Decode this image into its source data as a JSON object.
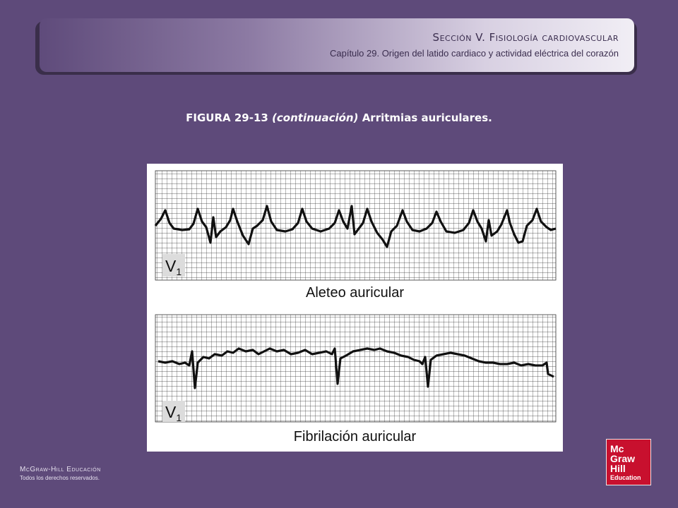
{
  "header": {
    "section": "Sección V.  Fisiología cardiovascular",
    "chapter": "Capítulo 29.  Origen del latido cardiaco y actividad eléctrica del corazón"
  },
  "caption": {
    "number": "FIGURA 29-13",
    "emphasis": "(continuación)",
    "text": "Arritmias auriculares."
  },
  "figure": {
    "top_trace": {
      "lead": "V",
      "lead_sub": "1",
      "label": "Aleteo auricular"
    },
    "bottom_trace": {
      "lead": "V",
      "lead_sub": "1",
      "label": "Fibrilación auricular"
    }
  },
  "footer": {
    "brand": "McGraw-Hill Educación",
    "rights": "Todos los derechos reservados."
  },
  "logo": {
    "line1": "Mc",
    "line2": "Graw",
    "line3": "Hill",
    "line4": "Education"
  },
  "colors": {
    "background": "#5e4a7a",
    "logo_red": "#c8102e",
    "trace": "#111111",
    "grid": "#333333"
  }
}
